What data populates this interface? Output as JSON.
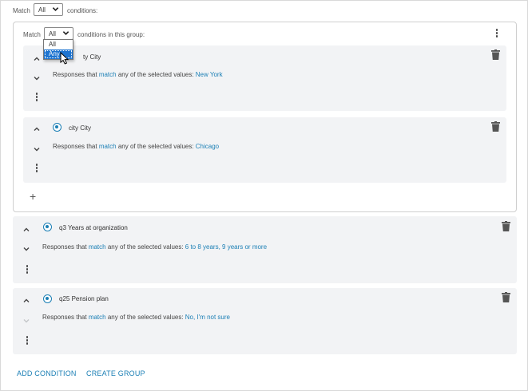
{
  "top": {
    "match_label": "Match",
    "match_value": "All",
    "conditions_label": "conditions:"
  },
  "group": {
    "match_label": "Match",
    "match_value": "All",
    "conditions_label": "conditions in this group:",
    "dropdown_options": [
      "All",
      "Any"
    ],
    "highlighted_option": "Any",
    "conditions": [
      {
        "title": "city City",
        "title_visible_fragment": "ty City",
        "prefix": "Responses that ",
        "op": "match",
        "mid": " any of the selected values: ",
        "values": "New York"
      },
      {
        "title": "city City",
        "prefix": "Responses that ",
        "op": "match",
        "mid": " any of the selected values: ",
        "values": "Chicago"
      }
    ],
    "add_icon": "plus-icon"
  },
  "conditions": [
    {
      "title": "q3 Years at organization",
      "prefix": "Responses that ",
      "op": "match",
      "mid": " any of the selected values: ",
      "values": "6 to 8 years, 9 years or more"
    },
    {
      "title": "q25 Pension plan",
      "prefix": "Responses that ",
      "op": "match",
      "mid": " any of the selected values: ",
      "values": "No, I'm not sure"
    }
  ],
  "actions": {
    "add_condition": "ADD CONDITION",
    "create_group": "CREATE GROUP"
  },
  "colors": {
    "accent": "#1b7fb5",
    "card_bg": "#f2f3f5",
    "selected_option": "#1e74d0"
  },
  "icons": [
    "chevron-up-icon",
    "chevron-down-icon",
    "more-vertical-icon",
    "trash-icon",
    "radio-selected-icon",
    "plus-icon",
    "mouse-cursor-icon"
  ]
}
